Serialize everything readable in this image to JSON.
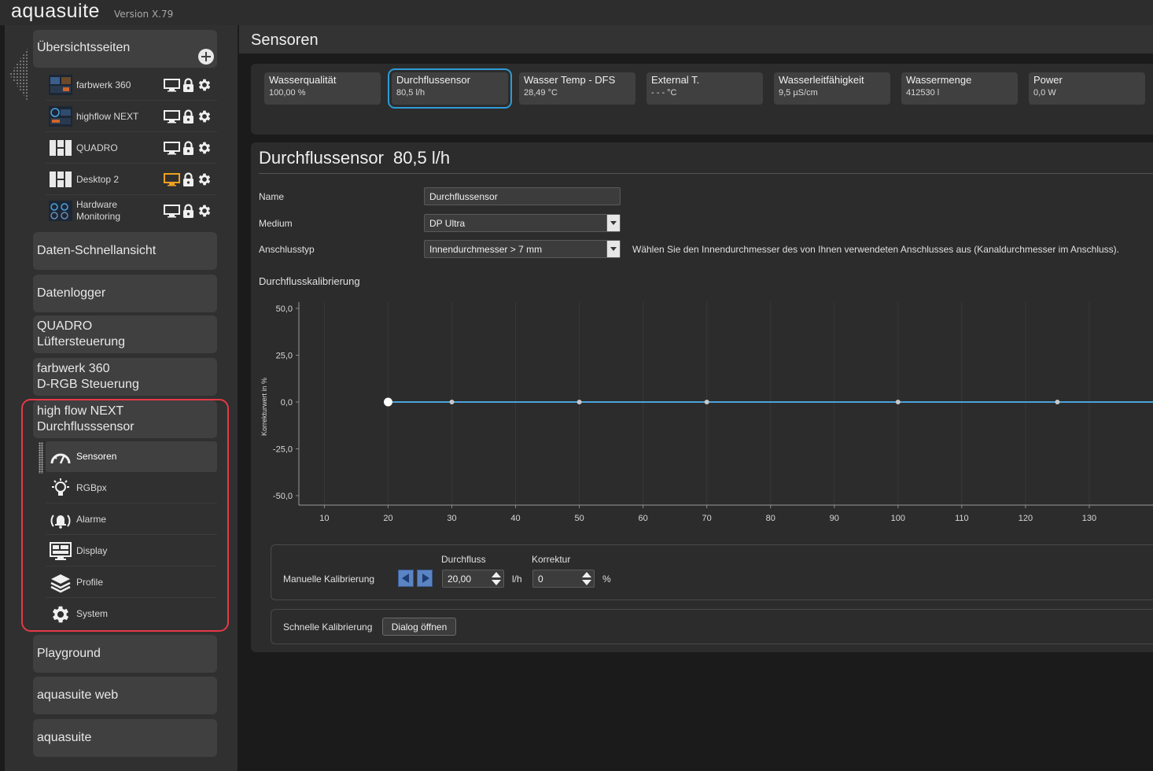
{
  "app": {
    "title": "aquasuite",
    "version": "Version X.79"
  },
  "sidebar": {
    "overview": {
      "label": "Übersichtsseiten",
      "add_icon": "plus-circle-icon",
      "items": [
        {
          "label": "farbwerk 360",
          "thumb": "farbwerk-thumbnail",
          "monitor_color": "#f0f0f0"
        },
        {
          "label": "highflow NEXT",
          "thumb": "highflow-thumbnail",
          "monitor_color": "#f0f0f0"
        },
        {
          "label": "QUADRO",
          "thumb": "quadro-thumbnail",
          "monitor_color": "#f0f0f0"
        },
        {
          "label": "Desktop 2",
          "thumb": "desktop-thumbnail",
          "monitor_color": "#f0a020"
        },
        {
          "label_line1": "Hardware",
          "label_line2": "Monitoring",
          "thumb": "hardware-monitoring-thumbnail",
          "monitor_color": "#f0f0f0"
        }
      ]
    },
    "nav": {
      "daten_schnellansicht": "Daten-Schnellansicht",
      "datenlogger": "Datenlogger",
      "quadro_line1": "QUADRO",
      "quadro_line2": "Lüftersteuerung",
      "farbwerk_line1": "farbwerk 360",
      "farbwerk_line2": "D-RGB Steuerung",
      "highflow_line1": "high flow NEXT",
      "highflow_line2": "Durchflusssensor",
      "playground": "Playground",
      "aquasuite_web": "aquasuite web",
      "aquasuite": "aquasuite"
    },
    "highflow_sub": [
      {
        "label": "Sensoren",
        "icon": "gauge-icon"
      },
      {
        "label": "RGBpx",
        "icon": "lightbulb-icon"
      },
      {
        "label": "Alarme",
        "icon": "alarm-bell-icon"
      },
      {
        "label": "Display",
        "icon": "display-icon"
      },
      {
        "label": "Profile",
        "icon": "layers-icon"
      },
      {
        "label": "System",
        "icon": "gear-icon"
      }
    ],
    "highlight_color": "#e53946"
  },
  "page": {
    "title": "Sensoren"
  },
  "sensor_tiles": [
    {
      "name": "Wasserqualität",
      "value": "100,00 %"
    },
    {
      "name": "Durchflussensor",
      "value": "80,5 l/h",
      "selected": true
    },
    {
      "name": "Wasser Temp - DFS",
      "value": "28,49 °C"
    },
    {
      "name": "External T.",
      "value": "- - - °C"
    },
    {
      "name": "Wasserleitfähigkeit",
      "value": "9,5 µS/cm"
    },
    {
      "name": "Wassermenge",
      "value": "412530 l"
    },
    {
      "name": "Power",
      "value": "0,0 W"
    }
  ],
  "detail": {
    "title": "Durchflussensor",
    "value": "80,5 l/h",
    "form": {
      "name_label": "Name",
      "name_value": "Durchflussensor",
      "medium_label": "Medium",
      "medium_value": "DP Ultra",
      "anschluss_label": "Anschlusstyp",
      "anschluss_value": "Innendurchmesser > 7 mm",
      "anschluss_hint": "Wählen Sie den Innendurchmesser des von Ihnen verwendeten Anschlusses aus (Kanaldurchmesser im Anschluss)."
    },
    "calibration_title": "Durchflusskalibrierung"
  },
  "chart_data": {
    "type": "line",
    "ylabel": "Korrekturwert in %",
    "xlabel": "",
    "y_ticks": [
      "50,0",
      "25,0",
      "0,0",
      "-25,0",
      "-50,0"
    ],
    "x_ticks": [
      "10",
      "20",
      "30",
      "40",
      "50",
      "60",
      "70",
      "80",
      "90",
      "100",
      "110",
      "120",
      "130"
    ],
    "ylim": [
      -50,
      50
    ],
    "xlim": [
      6,
      140
    ],
    "grid": true,
    "line_color": "#4aa3df",
    "series": [
      {
        "x": [
          20,
          30,
          50,
          70,
          100,
          125,
          140
        ],
        "y": [
          0,
          0,
          0,
          0,
          0,
          0,
          0
        ]
      }
    ],
    "selected_point": {
      "x": 20,
      "y": 0
    }
  },
  "manual_calibration": {
    "label": "Manuelle Kalibrierung",
    "durchfluss_label": "Durchfluss",
    "durchfluss_value": "20,00",
    "durchfluss_unit": "l/h",
    "korrektur_label": "Korrektur",
    "korrektur_value": "0",
    "korrektur_unit": "%"
  },
  "quick_calibration": {
    "label": "Schnelle Kalibrierung",
    "button": "Dialog öffnen"
  },
  "colors": {
    "accent": "#2e9bd6",
    "chart_line": "#4aa3df",
    "panel": "#2c2c2c",
    "sidebar": "#303030"
  }
}
